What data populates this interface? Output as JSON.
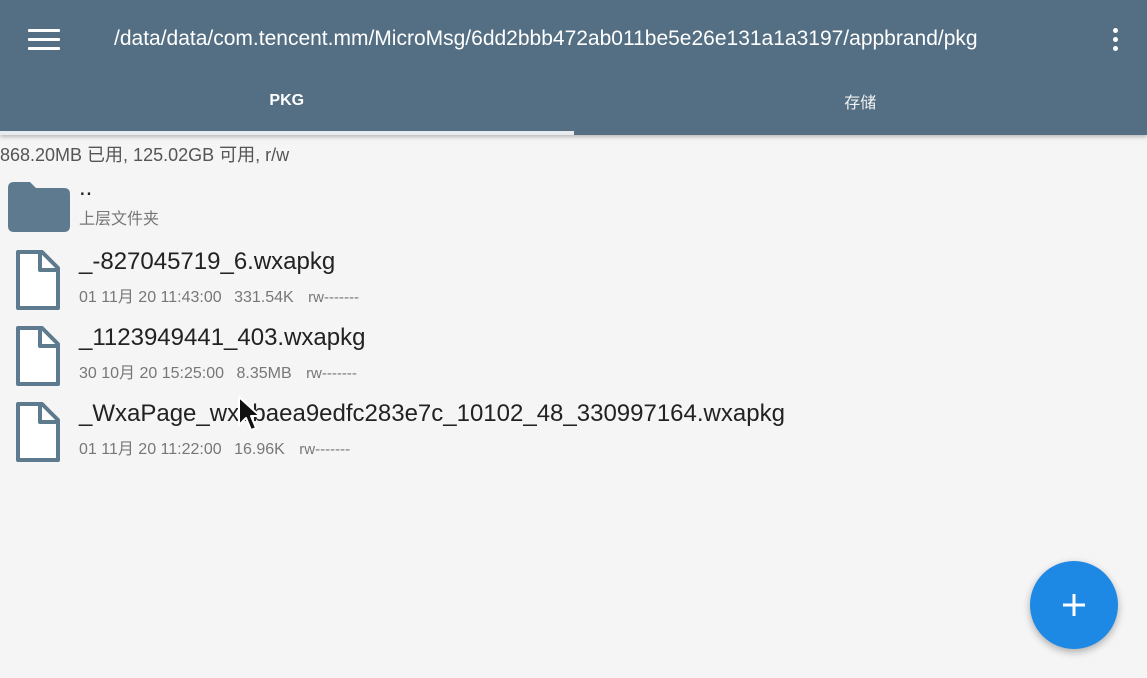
{
  "toolbar": {
    "path": "/data/data/com.tencent.mm/MicroMsg/6dd2bbb472ab011be5e26e131a1a3197/appbrand/pkg",
    "menu_icon": "hamburger-menu-icon",
    "more_icon": "more-vertical-icon"
  },
  "tabs": [
    {
      "label": "PKG",
      "active": true
    },
    {
      "label": "存储",
      "active": false
    }
  ],
  "storage": {
    "text": "868.20MB 已用, 125.02GB 可用, r/w"
  },
  "files": [
    {
      "name": "..",
      "subtitle": "上层文件夹",
      "type": "folder"
    },
    {
      "name": "_-827045719_6.wxapkg",
      "date": "01 11月 20 11:43:00",
      "size": "331.54K",
      "perm": "rw-------",
      "type": "file"
    },
    {
      "name": "_1123949441_403.wxapkg",
      "date": "30 10月 20 15:25:00",
      "size": "8.35MB",
      "perm": "rw-------",
      "type": "file"
    },
    {
      "name": "_WxaPage_wxebaea9edfc283e7c_10102_48_330997164.wxapkg",
      "date": "01 11月 20 11:22:00",
      "size": "16.96K",
      "perm": "rw-------",
      "type": "file"
    }
  ],
  "fab": {
    "icon": "plus-icon"
  },
  "colors": {
    "appbar": "#546f83",
    "accent": "#1e88e5",
    "icon": "#5d7a8e"
  }
}
